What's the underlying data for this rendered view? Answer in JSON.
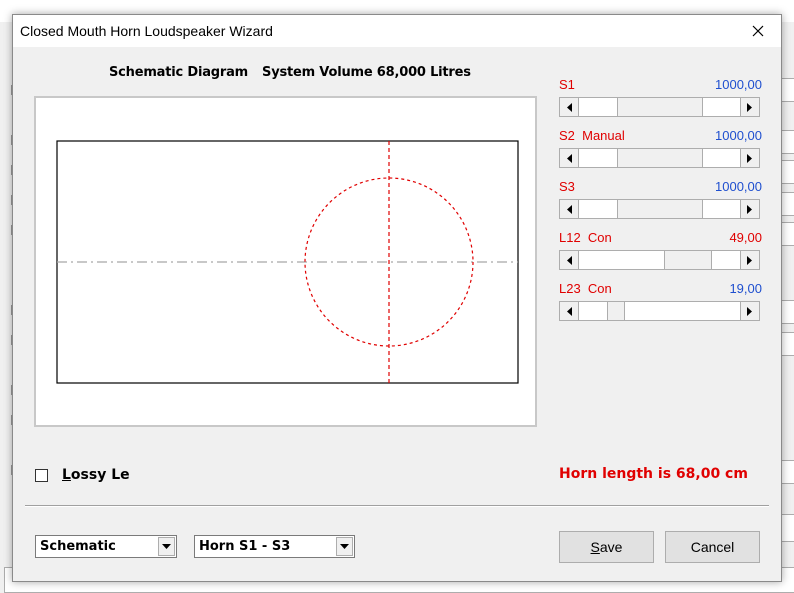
{
  "dialog": {
    "title": "Closed Mouth Horn Loudspeaker Wizard"
  },
  "schematic": {
    "heading": "Schematic Diagram",
    "volume_text": "System Volume 68,000 Litres"
  },
  "params": [
    {
      "label": "S1",
      "value": "1000,00",
      "value_color": "#1f4fcf",
      "position": 0.5
    },
    {
      "label": "S2  Manual",
      "value": "1000,00",
      "value_color": "#1f4fcf",
      "position": 0.5
    },
    {
      "label": "S3",
      "value": "1000,00",
      "value_color": "#1f4fcf",
      "position": 0.5
    },
    {
      "label": "L12  Con",
      "value": "49,00",
      "value_color": "#e00000",
      "position": 0.75
    },
    {
      "label": "L23  Con",
      "value": "19,00",
      "value_color": "#1f4fcf",
      "position": 0.2
    }
  ],
  "lossy": {
    "label": "Lossy Le",
    "checked": false
  },
  "status": {
    "horn_length": "Horn length is 68,00 cm"
  },
  "view_select": {
    "value": "Schematic"
  },
  "section_select": {
    "value": "Horn S1 - S3"
  },
  "buttons": {
    "save": "Save",
    "cancel": "Cancel"
  },
  "colors": {
    "accent_red": "#e00000",
    "value_blue": "#1f4fcf"
  }
}
